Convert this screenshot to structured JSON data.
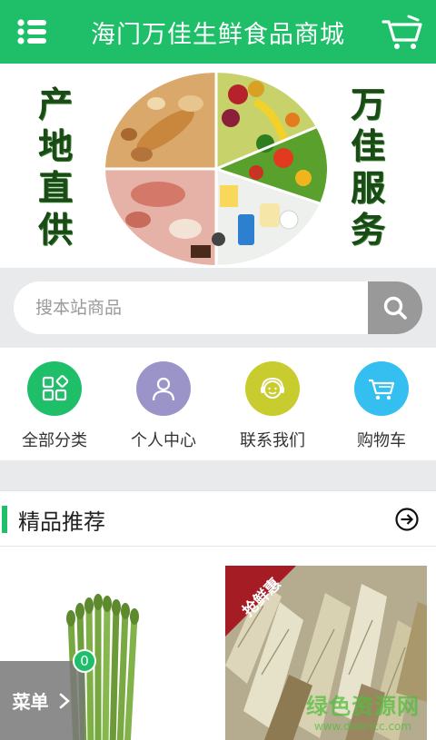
{
  "header": {
    "title": "海门万佳生鲜食品商城",
    "menu_icon": "list-menu-icon",
    "cart_icon": "shopping-cart-icon",
    "bg_color": "#1fbf6a"
  },
  "banner": {
    "left_slogan": [
      "产",
      "地",
      "直",
      "供"
    ],
    "right_slogan": [
      "万",
      "佳",
      "服",
      "务"
    ]
  },
  "search": {
    "placeholder": "搜本站商品",
    "button_icon": "search-icon"
  },
  "quick_nav": [
    {
      "label": "全部分类",
      "icon": "category-grid-icon",
      "color": "#1fbf6a"
    },
    {
      "label": "个人中心",
      "icon": "user-icon",
      "color": "#9a94c9"
    },
    {
      "label": "联系我们",
      "icon": "customer-service-icon",
      "color": "#c8cc2e"
    },
    {
      "label": "购物车",
      "icon": "shopping-cart-icon",
      "color": "#35bff0"
    }
  ],
  "recommend": {
    "title": "精品推荐",
    "more_icon": "arrow-circle-right-icon",
    "products": [
      {
        "name": "asparagus",
        "badge": ""
      },
      {
        "name": "bamboo-shoots",
        "badge": "抢鲜惠"
      }
    ]
  },
  "float_menu": {
    "label": "菜单",
    "cart_count": "0"
  },
  "watermark": {
    "line1": "绿色资源网",
    "line2": "www.downcc.com"
  }
}
